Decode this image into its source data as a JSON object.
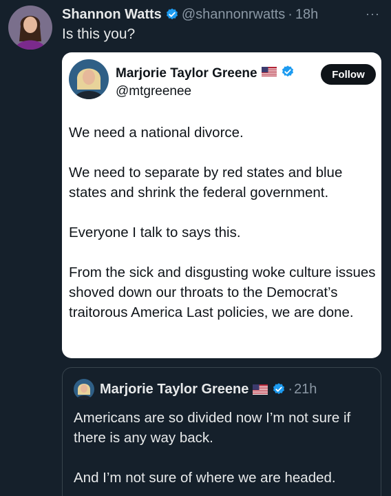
{
  "tweet": {
    "author_name": "Shannon Watts",
    "author_handle": "@shannonrwatts",
    "separator": "·",
    "time": "18h",
    "more_label": "···",
    "text": "Is this you?"
  },
  "embedded_post": {
    "author_name": "Marjorie Taylor Greene",
    "author_handle": "@mtgreenee",
    "follow_label": "Follow",
    "flag": "🇺🇸",
    "paragraphs": [
      "We need a national divorce.",
      "We need to separate by red states and blue states and shrink the federal government.",
      "Everyone I talk to says this.",
      "From the sick and disgusting woke culture issues shoved down our throats to the Democrat’s traitorous America Last policies, we are done."
    ]
  },
  "quoted_post": {
    "author_name": "Marjorie Taylor Greene",
    "flag": "🇺🇸",
    "separator": "·",
    "time": "21h",
    "paragraphs": [
      "Americans are so divided now I’m not sure if there is any way back.",
      "And I’m not sure of where we are headed."
    ]
  },
  "colors": {
    "background": "#15202b",
    "verified_blue": "#1d9bf0",
    "muted_text": "#8b98a5",
    "card_border": "#38444d"
  },
  "icons": {
    "verified": "verified-badge-icon",
    "flag": "us-flag-icon",
    "more": "more-options-icon"
  }
}
